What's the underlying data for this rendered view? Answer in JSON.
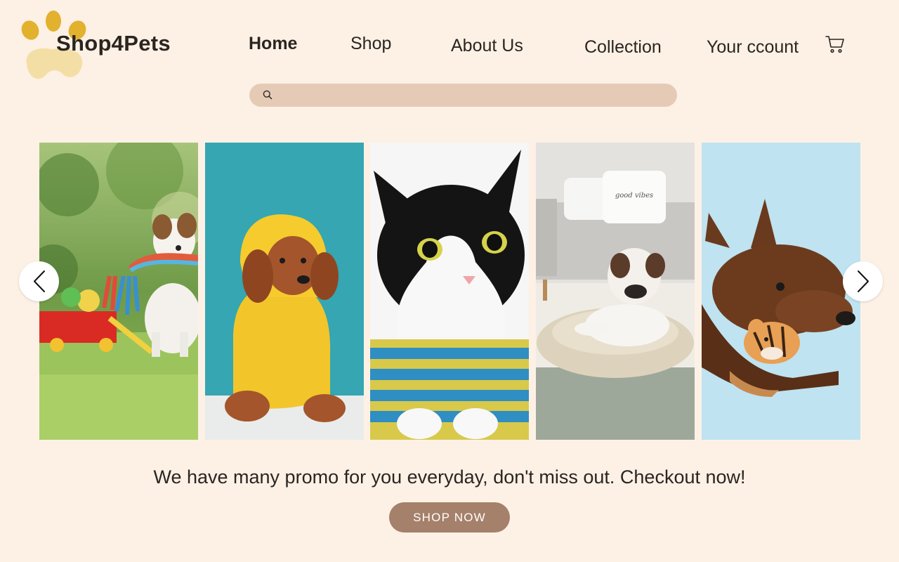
{
  "brand": {
    "name": "Shop4Pets",
    "logo_icon": "paw-print-icon",
    "logo_colors": {
      "toes": "#e2b12e",
      "pad": "#f3dfa6"
    }
  },
  "nav": {
    "items": [
      {
        "label": "Home",
        "active": true
      },
      {
        "label": "Shop",
        "active": false
      },
      {
        "label": "About Us",
        "active": false
      },
      {
        "label": "Collection",
        "active": false
      },
      {
        "label": "Your ccount",
        "active": false
      }
    ],
    "cart_icon": "shopping-cart-icon"
  },
  "search": {
    "placeholder": "",
    "icon": "search-icon"
  },
  "carousel": {
    "prev_icon": "chevron-left-icon",
    "next_icon": "chevron-right-icon",
    "slides": [
      {
        "subject": "dog-with-rope-toy"
      },
      {
        "subject": "poodle-in-yellow-hoodie"
      },
      {
        "subject": "cat-in-striped-sweater"
      },
      {
        "subject": "bulldog-on-pet-bed"
      },
      {
        "subject": "dog-with-tiger-plush"
      }
    ],
    "bed_pillow_text": "good vibes"
  },
  "promo": {
    "text": "We have many promo for you everyday, don't miss out. Checkout now!",
    "button_label": "SHOP NOW"
  },
  "colors": {
    "background": "#fdf1e6",
    "search_bar": "#e5cbb6",
    "button": "#a5806a",
    "text": "#2b2520"
  }
}
